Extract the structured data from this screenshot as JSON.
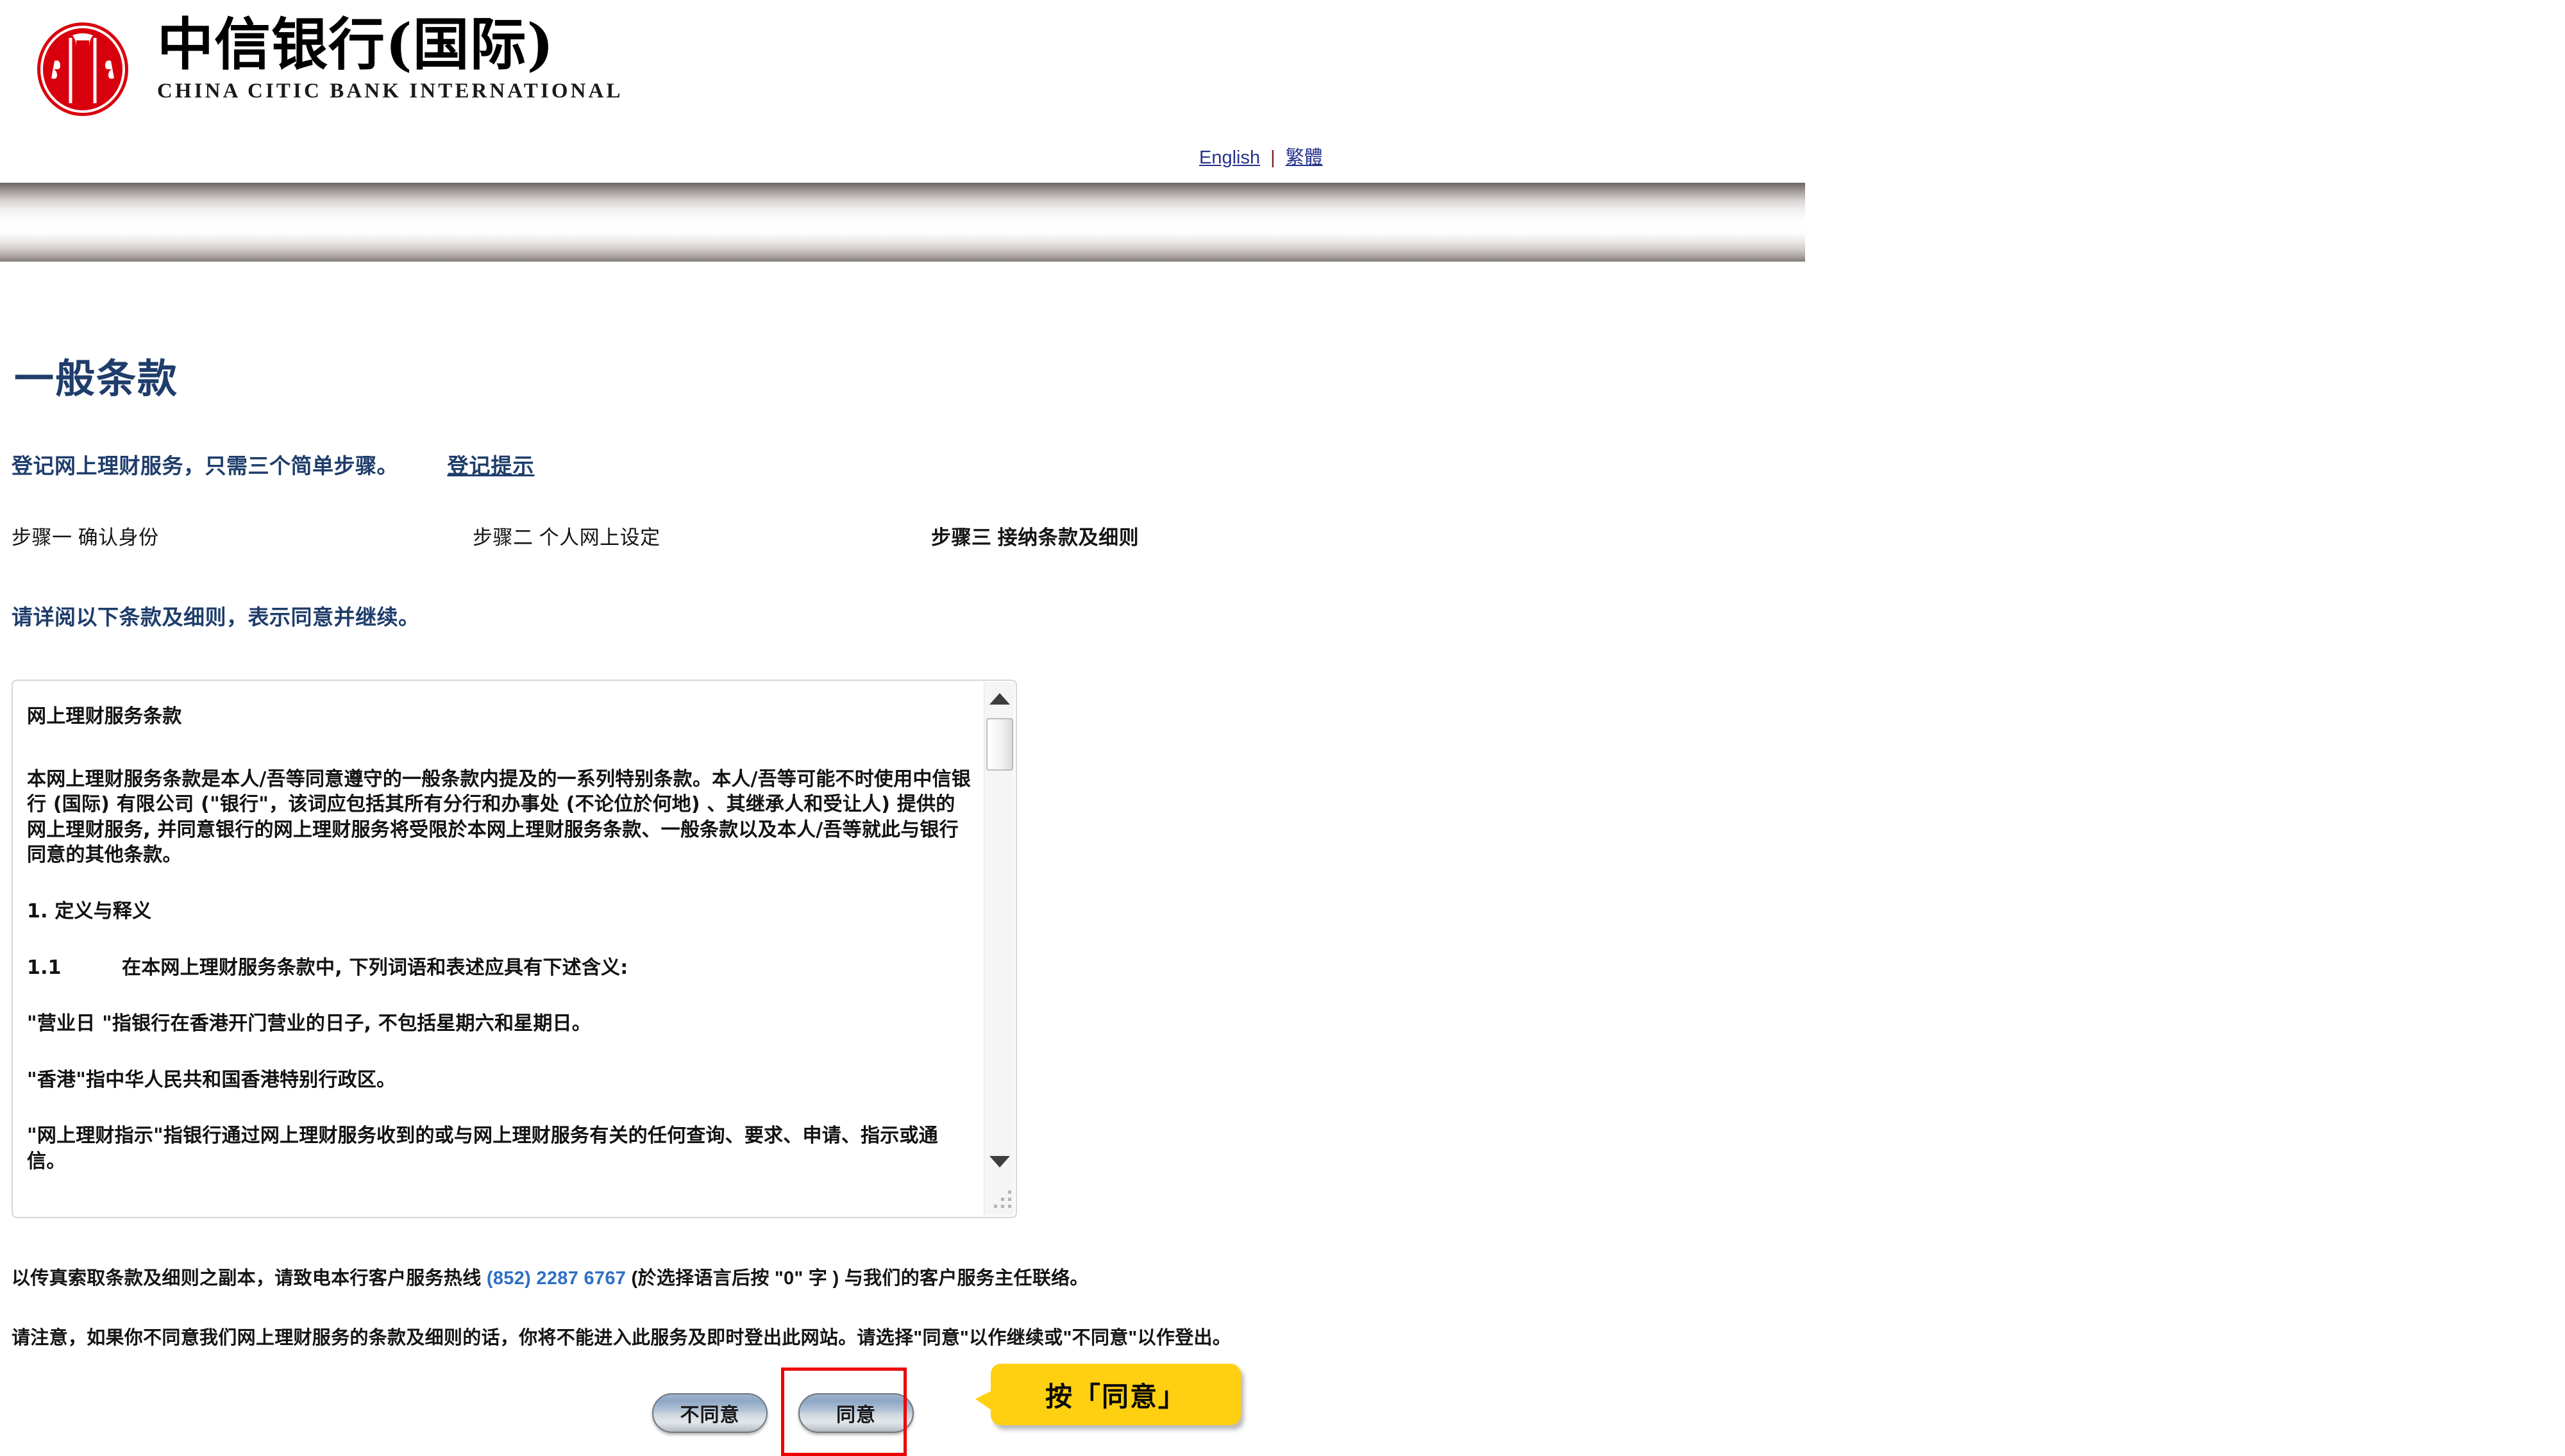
{
  "header": {
    "logo": {
      "mark_name": "citic-logo-mark",
      "brand_cn": "中信银行(国际)",
      "brand_en": "CHINA CITIC BANK INTERNATIONAL",
      "brand_color": "#d9000d"
    },
    "language": {
      "english": "English",
      "separator": "|",
      "traditional": "繁體"
    }
  },
  "main": {
    "title": "一般条款",
    "subtitle": "登记网上理财服务，只需三个简单步骤。",
    "hint_link": "登记提示",
    "steps": [
      {
        "label": "步骤一 确认身份",
        "active": false
      },
      {
        "label": "步骤二 个人网上设定",
        "active": false
      },
      {
        "label": "步骤三 接纳条款及细则",
        "active": true
      }
    ],
    "instruction": "请详阅以下条款及细则，表示同意并继续。"
  },
  "terms": {
    "heading": "网上理财服务条款",
    "paragraph_1": "本网上理财服务条款是本人/吾等同意遵守的一般条款内提及的一系列特别条款。本人/吾等可能不时使用中信银行 (国际) 有限公司 (\"银行\"，该词应包括其所有分行和办事处 (不论位於何地) 、其继承人和受让人) 提供的网上理财服务, 并同意银行的网上理财服务将受限於本网上理财服务条款、一般条款以及本人/吾等就此与银行同意的其他条款。",
    "section_1_title": "1. 定义与释义",
    "clause_1_1_num": "1.1",
    "clause_1_1_text": "在本网上理财服务条款中, 下列词语和表述应具有下述含义:",
    "definition_business_day": "\"营业日 \"指银行在香港开门营业的日子, 不包括星期六和星期日。",
    "definition_hong_kong": "\"香港\"指中华人民共和国香港特别行政区。",
    "definition_instruction": "\"网上理财指示\"指银行通过网上理财服务收到的或与网上理财服务有关的任何查询、要求、申请、指示或通信。",
    "scrollbar": {
      "up_icon": "scroll-up-arrow-icon",
      "down_icon": "scroll-down-arrow-icon",
      "resize_icon": "resize-grip-icon"
    }
  },
  "footer": {
    "line_1_before": "以传真索取条款及细则之副本，请致电本行客户服务热线 ",
    "line_1_phone": "(852) 2287 6767",
    "line_1_after": " (於选择语言后按 \"0\" 字 ) 与我们的客户服务主任联络。",
    "line_2": "请注意，如果你不同意我们网上理财服务的条款及细则的话，你将不能进入此服务及即时登出此网站。请选择\"同意\"以作继续或\"不同意\"以作登出。"
  },
  "actions": {
    "disagree_label": "不同意",
    "agree_label": "同意",
    "highlight_color": "#ee0000",
    "callout": {
      "text": "按「同意」",
      "background": "#ffd011"
    }
  }
}
